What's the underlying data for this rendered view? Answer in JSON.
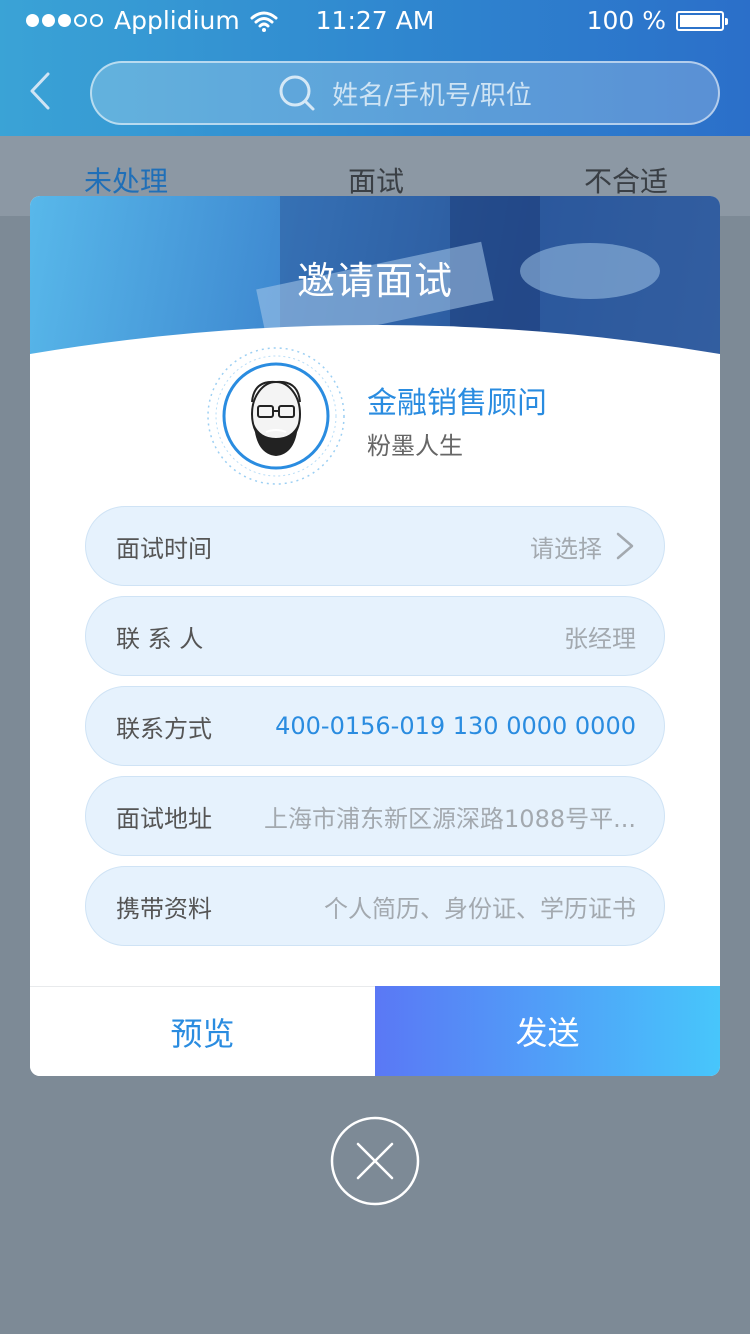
{
  "status_bar": {
    "carrier": "Applidium",
    "time": "11:27 AM",
    "battery": "100 %"
  },
  "search": {
    "placeholder": "姓名/手机号/职位"
  },
  "tabs": [
    {
      "label": "未处理",
      "active": true
    },
    {
      "label": "面试",
      "active": false
    },
    {
      "label": "不合适",
      "active": false
    }
  ],
  "dialog": {
    "title": "邀请面试",
    "job_title": "金融销售顾问",
    "company": "粉墨人生",
    "fields": [
      {
        "label": "面试时间",
        "value": "请选择"
      },
      {
        "label": "联 系 人",
        "value": "张经理"
      },
      {
        "label": "联系方式",
        "value": "400-0156-019  130 0000 0000"
      },
      {
        "label": "面试地址",
        "value": "上海市浦东新区源深路1088号平..."
      },
      {
        "label": "携带资料",
        "value": "个人简历、身份证、学历证书"
      }
    ],
    "preview_label": "预览",
    "send_label": "发送"
  },
  "colors": {
    "accent": "#2a8ce0",
    "header_start": "#3aa3d6",
    "header_end": "#2b6fc9",
    "send_start": "#5a78f5",
    "send_end": "#47c6fb"
  }
}
